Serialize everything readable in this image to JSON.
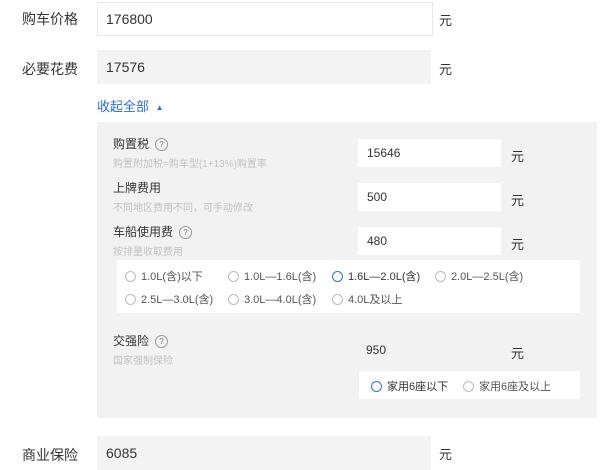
{
  "purchase_price": {
    "label": "购车价格",
    "value": "176800",
    "unit": "元"
  },
  "required_fees": {
    "label": "必要花费",
    "value": "17576",
    "unit": "元"
  },
  "collapse_toggle": {
    "label": "收起全部",
    "arrow": "▲"
  },
  "purchase_tax": {
    "label": "购置税",
    "hint": "购置附加税=购车型(1+13%)购置率",
    "value": "15646",
    "unit": "元"
  },
  "plate_fee": {
    "label": "上牌费用",
    "hint": "不同地区费用不同，可手动修改",
    "value": "500",
    "unit": "元"
  },
  "vessel_tax": {
    "label": "车船使用费",
    "hint": "按排量收取费用",
    "value": "480",
    "unit": "元",
    "options": [
      "1.0L(含)以下",
      "1.0L—1.6L(含)",
      "1.6L—2.0L(含)",
      "2.0L—2.5L(含)",
      "2.5L—3.0L(含)",
      "3.0L—4.0L(含)",
      "4.0L及以上"
    ],
    "selected": "1.6L—2.0L(含)"
  },
  "compulsory_insurance": {
    "label": "交强险",
    "hint": "国家强制保险",
    "value": "950",
    "unit": "元",
    "options": [
      "家用6座以下",
      "家用6座及以上"
    ],
    "selected": "家用6座以下"
  },
  "commercial_insurance": {
    "label": "商业保险",
    "value": "6085",
    "unit": "元"
  },
  "colors": {
    "accent": "#2b6de0",
    "panel_bg": "#f2f2f2",
    "input_bg": "#f3f3f3"
  }
}
